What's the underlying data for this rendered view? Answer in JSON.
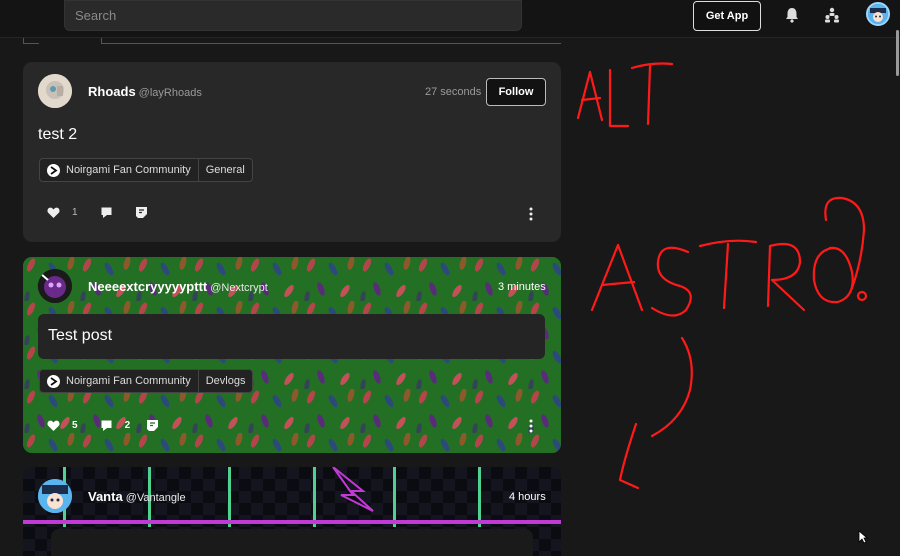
{
  "header": {
    "search_placeholder": "Search",
    "get_app_label": "Get App",
    "icons": [
      "bell-icon",
      "people-icon",
      "avatar"
    ]
  },
  "posts": [
    {
      "username": "Rhoads",
      "handle": "@layRhoads",
      "time": "27 seconds",
      "follow_label": "Follow",
      "content": "test 2",
      "community": "Noirgami Fan Community",
      "channel": "General",
      "likes": "1",
      "comments": ""
    },
    {
      "username": "Neeeextcryyyyypttt",
      "handle": "@Nextcrypt",
      "time": "3 minutes",
      "content": "Test post",
      "community": "Noirgami Fan Community",
      "channel": "Devlogs",
      "likes": "5",
      "comments": "2"
    },
    {
      "username": "Vanta",
      "handle": "@Vantangle",
      "time": "4 hours"
    }
  ],
  "colors": {
    "background": "#181818",
    "card": "#282828",
    "green_card": "#1f6a1f",
    "annotation_red": "#ff1a1a"
  }
}
